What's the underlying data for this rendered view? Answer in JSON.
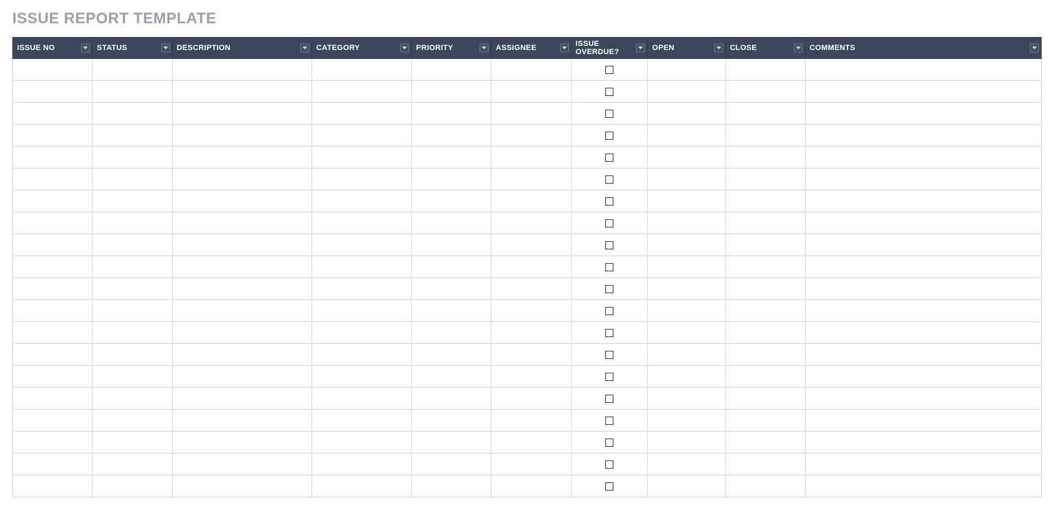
{
  "title": "ISSUE REPORT TEMPLATE",
  "columns": [
    {
      "key": "issue_no",
      "label": "ISSUE NO",
      "type": "text"
    },
    {
      "key": "status",
      "label": "STATUS",
      "type": "text"
    },
    {
      "key": "desc",
      "label": "DESCRIPTION",
      "type": "text"
    },
    {
      "key": "category",
      "label": "CATEGORY",
      "type": "text"
    },
    {
      "key": "priority",
      "label": "PRIORITY",
      "type": "text"
    },
    {
      "key": "assignee",
      "label": "ASSIGNEE",
      "type": "text"
    },
    {
      "key": "overdue",
      "label": "ISSUE OVERDUE?",
      "type": "checkbox"
    },
    {
      "key": "open",
      "label": "OPEN",
      "type": "text"
    },
    {
      "key": "close",
      "label": "CLOSE",
      "type": "text"
    },
    {
      "key": "comments",
      "label": "COMMENTS",
      "type": "text"
    }
  ],
  "rows": [
    {
      "issue_no": "",
      "status": "",
      "desc": "",
      "category": "",
      "priority": "",
      "assignee": "",
      "overdue": false,
      "open": "",
      "close": "",
      "comments": ""
    },
    {
      "issue_no": "",
      "status": "",
      "desc": "",
      "category": "",
      "priority": "",
      "assignee": "",
      "overdue": false,
      "open": "",
      "close": "",
      "comments": ""
    },
    {
      "issue_no": "",
      "status": "",
      "desc": "",
      "category": "",
      "priority": "",
      "assignee": "",
      "overdue": false,
      "open": "",
      "close": "",
      "comments": ""
    },
    {
      "issue_no": "",
      "status": "",
      "desc": "",
      "category": "",
      "priority": "",
      "assignee": "",
      "overdue": false,
      "open": "",
      "close": "",
      "comments": ""
    },
    {
      "issue_no": "",
      "status": "",
      "desc": "",
      "category": "",
      "priority": "",
      "assignee": "",
      "overdue": false,
      "open": "",
      "close": "",
      "comments": ""
    },
    {
      "issue_no": "",
      "status": "",
      "desc": "",
      "category": "",
      "priority": "",
      "assignee": "",
      "overdue": false,
      "open": "",
      "close": "",
      "comments": ""
    },
    {
      "issue_no": "",
      "status": "",
      "desc": "",
      "category": "",
      "priority": "",
      "assignee": "",
      "overdue": false,
      "open": "",
      "close": "",
      "comments": ""
    },
    {
      "issue_no": "",
      "status": "",
      "desc": "",
      "category": "",
      "priority": "",
      "assignee": "",
      "overdue": false,
      "open": "",
      "close": "",
      "comments": ""
    },
    {
      "issue_no": "",
      "status": "",
      "desc": "",
      "category": "",
      "priority": "",
      "assignee": "",
      "overdue": false,
      "open": "",
      "close": "",
      "comments": ""
    },
    {
      "issue_no": "",
      "status": "",
      "desc": "",
      "category": "",
      "priority": "",
      "assignee": "",
      "overdue": false,
      "open": "",
      "close": "",
      "comments": ""
    },
    {
      "issue_no": "",
      "status": "",
      "desc": "",
      "category": "",
      "priority": "",
      "assignee": "",
      "overdue": false,
      "open": "",
      "close": "",
      "comments": ""
    },
    {
      "issue_no": "",
      "status": "",
      "desc": "",
      "category": "",
      "priority": "",
      "assignee": "",
      "overdue": false,
      "open": "",
      "close": "",
      "comments": ""
    },
    {
      "issue_no": "",
      "status": "",
      "desc": "",
      "category": "",
      "priority": "",
      "assignee": "",
      "overdue": false,
      "open": "",
      "close": "",
      "comments": ""
    },
    {
      "issue_no": "",
      "status": "",
      "desc": "",
      "category": "",
      "priority": "",
      "assignee": "",
      "overdue": false,
      "open": "",
      "close": "",
      "comments": ""
    },
    {
      "issue_no": "",
      "status": "",
      "desc": "",
      "category": "",
      "priority": "",
      "assignee": "",
      "overdue": false,
      "open": "",
      "close": "",
      "comments": ""
    },
    {
      "issue_no": "",
      "status": "",
      "desc": "",
      "category": "",
      "priority": "",
      "assignee": "",
      "overdue": false,
      "open": "",
      "close": "",
      "comments": ""
    },
    {
      "issue_no": "",
      "status": "",
      "desc": "",
      "category": "",
      "priority": "",
      "assignee": "",
      "overdue": false,
      "open": "",
      "close": "",
      "comments": ""
    },
    {
      "issue_no": "",
      "status": "",
      "desc": "",
      "category": "",
      "priority": "",
      "assignee": "",
      "overdue": false,
      "open": "",
      "close": "",
      "comments": ""
    },
    {
      "issue_no": "",
      "status": "",
      "desc": "",
      "category": "",
      "priority": "",
      "assignee": "",
      "overdue": false,
      "open": "",
      "close": "",
      "comments": ""
    },
    {
      "issue_no": "",
      "status": "",
      "desc": "",
      "category": "",
      "priority": "",
      "assignee": "",
      "overdue": false,
      "open": "",
      "close": "",
      "comments": ""
    }
  ],
  "colors": {
    "header_bg": "#3c475b",
    "title": "#9aa0a7",
    "grid": "#d6d9dd"
  }
}
